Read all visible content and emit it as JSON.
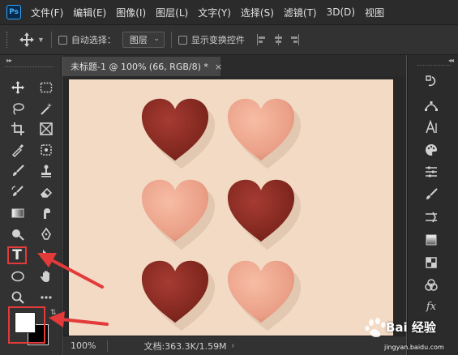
{
  "app": {
    "logo_text": "Ps",
    "menu": [
      "文件(F)",
      "编辑(E)",
      "图像(I)",
      "图层(L)",
      "文字(Y)",
      "选择(S)",
      "滤镜(T)",
      "3D(D)",
      "视图"
    ]
  },
  "options_bar": {
    "auto_select_label": "自动选择：",
    "auto_select_checked": false,
    "layer_select_value": "图层",
    "show_transform_label": "显示变换控件",
    "show_transform_checked": false
  },
  "document": {
    "tab_title": "未标题-1 @ 100% (66, RGB/8) *",
    "close_glyph": "×"
  },
  "status": {
    "zoom": "100%",
    "doc_info": "文档:363.3K/1.59M",
    "arrow_glyph": "›"
  },
  "tools": {
    "text_tool_label": "T",
    "highlighted_tool": "text-tool"
  },
  "colors": {
    "foreground": "#ffffff",
    "background": "#000000",
    "canvas_bg": "#f2dac4",
    "dark_heart": "#8a2e27",
    "light_heart": "#eaa28a",
    "highlight_red": "#e33a3a"
  },
  "canvas_content": {
    "hearts": [
      {
        "row": 1,
        "col": 1,
        "shade": "dark"
      },
      {
        "row": 1,
        "col": 2,
        "shade": "light"
      },
      {
        "row": 2,
        "col": 1,
        "shade": "light"
      },
      {
        "row": 2,
        "col": 2,
        "shade": "dark"
      },
      {
        "row": 3,
        "col": 1,
        "shade": "dark"
      },
      {
        "row": 3,
        "col": 2,
        "shade": "light"
      }
    ]
  },
  "right_panel": {
    "fx_label": "fx"
  },
  "watermark": {
    "text": "Bai 经验",
    "url": "jingyan.baidu.com"
  }
}
